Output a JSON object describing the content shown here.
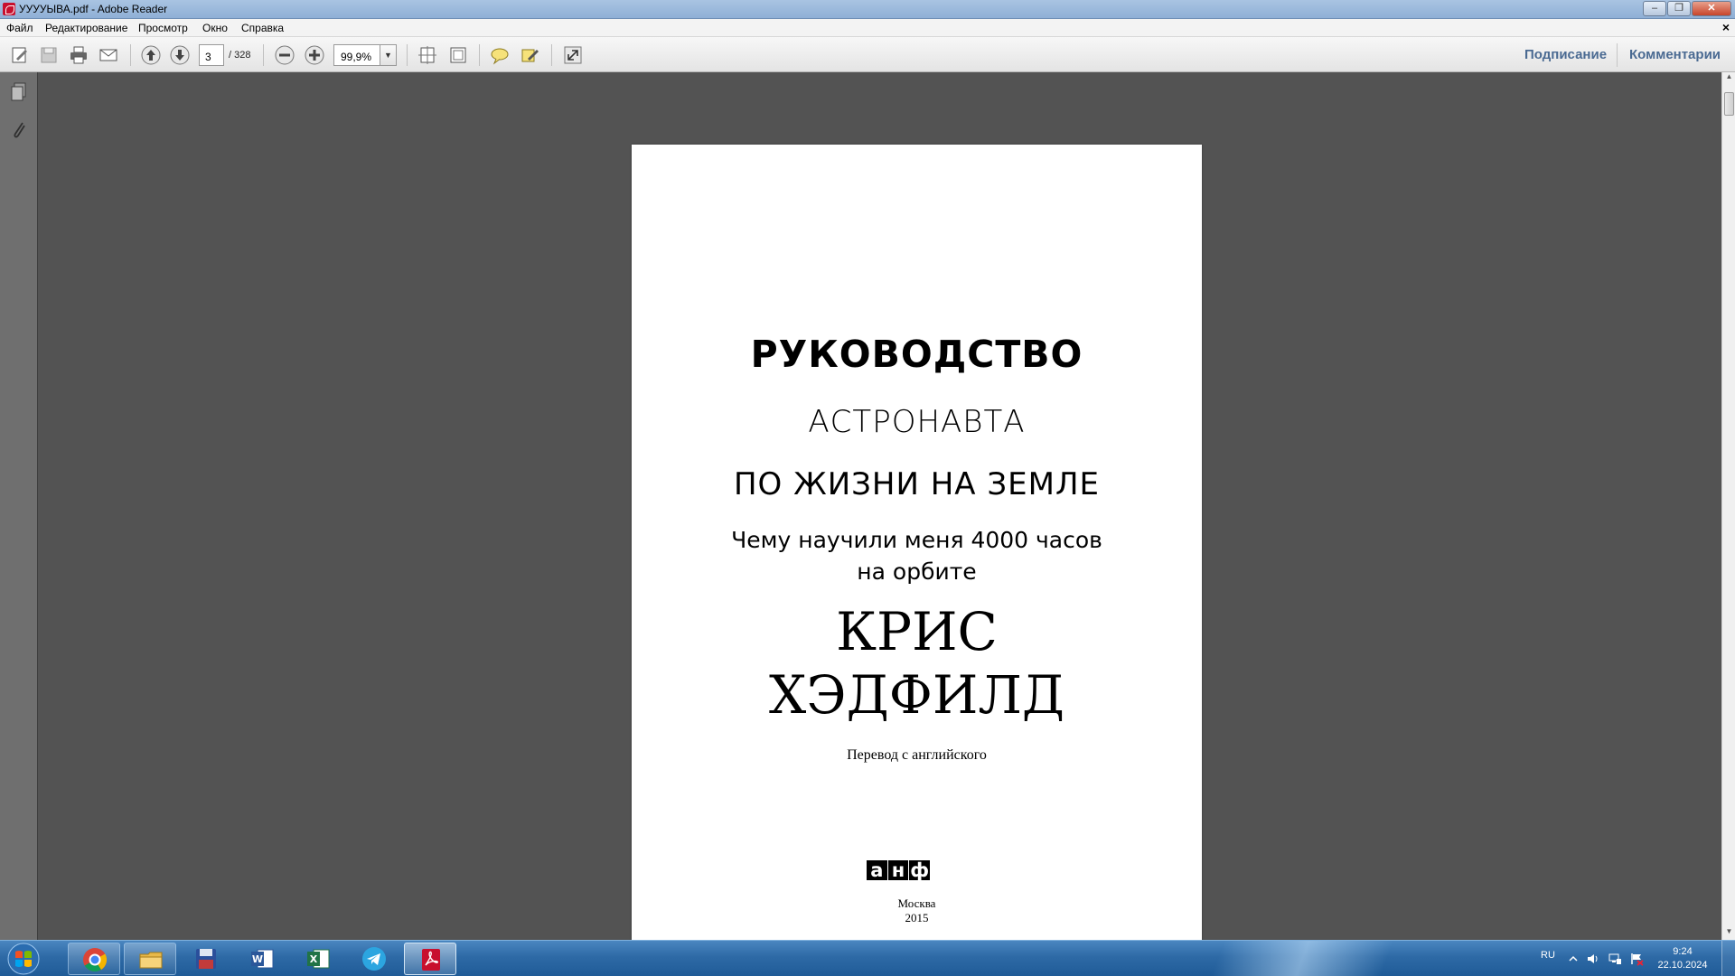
{
  "window": {
    "title": "УУУУЫВА.pdf - Adobe Reader"
  },
  "menu": {
    "items": [
      "Файл",
      "Редактирование",
      "Просмотр",
      "Окно",
      "Справка"
    ],
    "close_glyph": "×"
  },
  "toolbar": {
    "current_page": "3",
    "page_total": "/ 328",
    "zoom": "99,9%",
    "sign_label": "Подписание",
    "comments_label": "Комментарии"
  },
  "document": {
    "title_line1": "РУКОВОДСТВО",
    "title_line2": "АСТРОНАВТА",
    "title_line3": "ПО ЖИЗНИ НА ЗЕМЛЕ",
    "subtitle_line1": "Чему научили меня 4000 часов",
    "subtitle_line2": "на орбите",
    "author_line1": "КРИС",
    "author_line2": "ХЭДФИЛД",
    "translation_note": "Перевод с английского",
    "publisher_logo": [
      "а",
      "н",
      "ф"
    ],
    "city": "Москва",
    "year": "2015"
  },
  "taskbar": {
    "apps": [
      "chrome-icon",
      "folder-icon",
      "floppy-icon",
      "word-icon",
      "excel-icon",
      "telegram-icon",
      "adobe-reader-icon"
    ],
    "language": "RU",
    "time": "9:24",
    "date": "22.10.2024"
  }
}
